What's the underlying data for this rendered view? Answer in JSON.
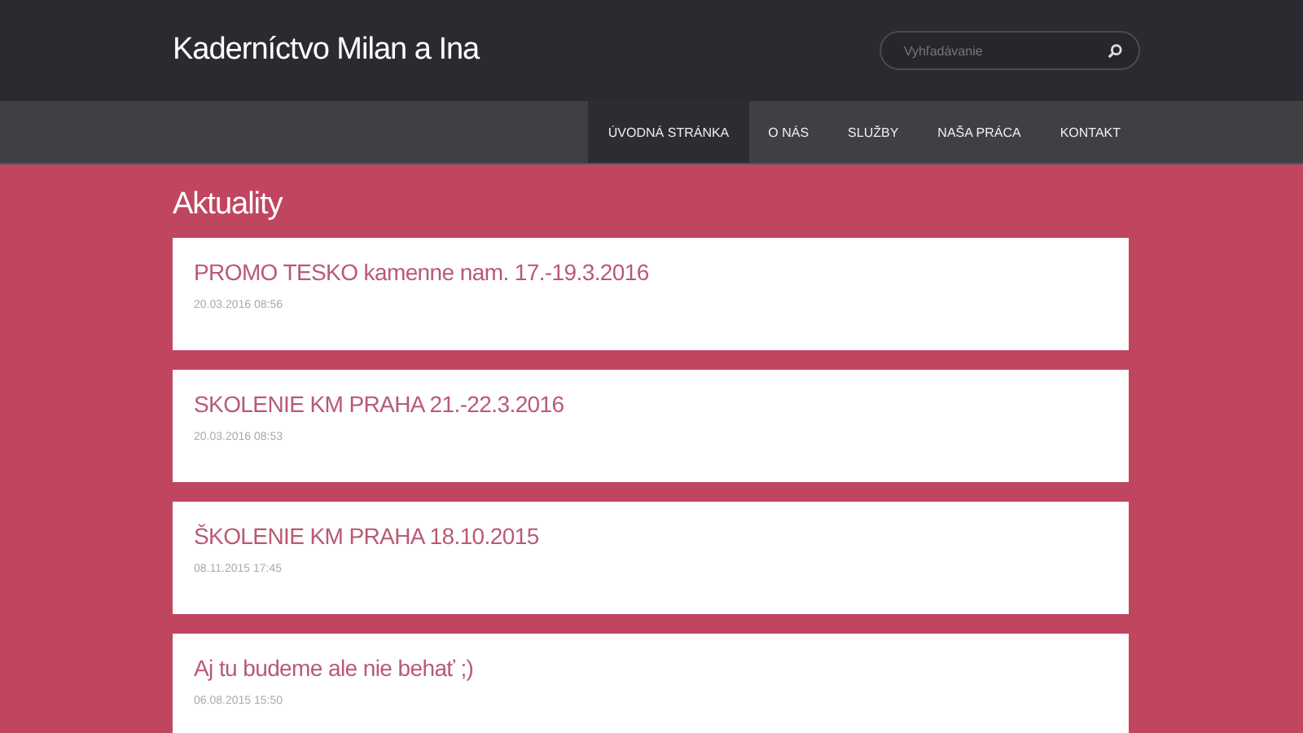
{
  "site_title": "Kaderníctvo Milan a Ina",
  "search": {
    "placeholder": "Vyhľadávanie"
  },
  "nav": [
    {
      "label": "ÚVODNÁ STRÁNKA",
      "selected": true
    },
    {
      "label": "O NÁS",
      "selected": false
    },
    {
      "label": "SLUŽBY",
      "selected": false
    },
    {
      "label": "NAŠA PRÁCA",
      "selected": false
    },
    {
      "label": "KONTAKT",
      "selected": false
    }
  ],
  "heading": "Aktuality",
  "articles": [
    {
      "title": "PROMO TESKO kamenne nam. 17.-19.3.2016",
      "date": "20.03.2016 08:56"
    },
    {
      "title": "SKOLENIE KM PRAHA 21.-22.3.2016",
      "date": "20.03.2016 08:53"
    },
    {
      "title": "ŠKOLENIE KM PRAHA 18.10.2015",
      "date": "08.11.2015 17:45"
    },
    {
      "title": "Aj tu budeme ale nie behať ;)",
      "date": "06.08.2015 15:50"
    }
  ]
}
